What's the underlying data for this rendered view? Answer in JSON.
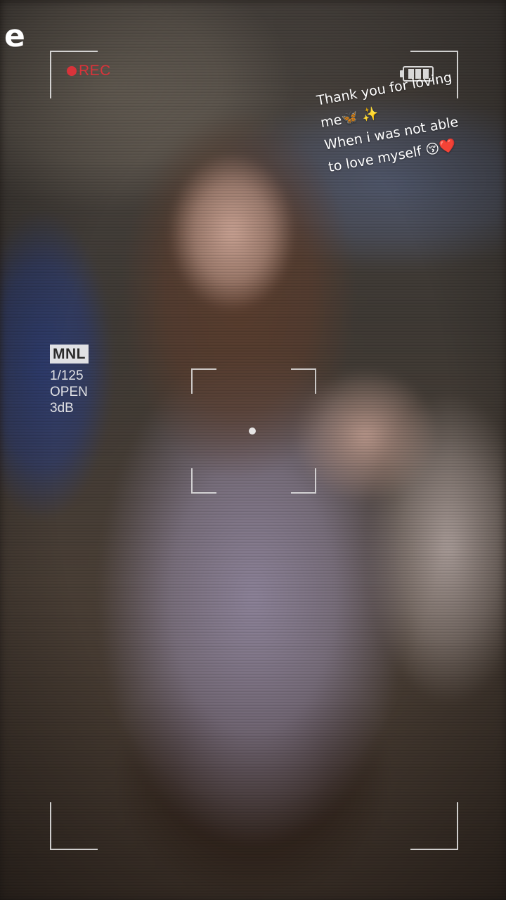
{
  "app_glyph": "e",
  "recording": {
    "label": "REC",
    "color": "#d8333a"
  },
  "battery": {
    "icon": "battery-icon",
    "bars": 3
  },
  "caption": {
    "lines": [
      "Thank you for loving",
      "me🦋 ✨",
      "When i was not able",
      "to love myself 😚❤️"
    ]
  },
  "camera_info": {
    "mode": "MNL",
    "shutter": "1/125",
    "aperture": "OPEN",
    "gain": "3dB"
  },
  "focus": {
    "icon": "focus-bracket-icon"
  },
  "frame": {
    "icon": "viewfinder-corners-icon"
  }
}
